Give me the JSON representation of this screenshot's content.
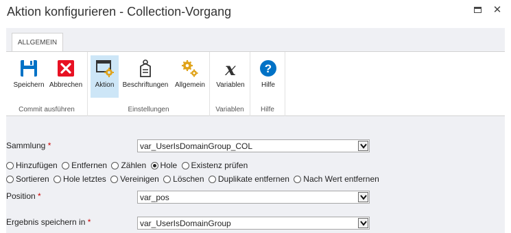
{
  "window": {
    "title": "Aktion konfigurieren - Collection-Vorgang",
    "maximize_icon": "maximize-icon",
    "close_glyph": "✕"
  },
  "tab": {
    "label": "ALLGEMEIN"
  },
  "ribbon": {
    "groups": [
      {
        "label": "Commit ausführen",
        "buttons": [
          {
            "label": "Speichern",
            "icon": "save-icon"
          },
          {
            "label": "Abbrechen",
            "icon": "cancel-icon"
          }
        ]
      },
      {
        "label": "Einstellungen",
        "buttons": [
          {
            "label": "Aktion",
            "icon": "action-settings-icon",
            "active": true
          },
          {
            "label": "Beschriftungen",
            "icon": "tag-icon"
          },
          {
            "label": "Allgemein",
            "icon": "gears-icon"
          }
        ]
      },
      {
        "label": "Variablen",
        "buttons": [
          {
            "label": "Variablen",
            "icon": "variable-x-icon"
          }
        ]
      },
      {
        "label": "Hilfe",
        "buttons": [
          {
            "label": "Hilfe",
            "icon": "help-icon"
          }
        ]
      }
    ]
  },
  "form": {
    "required_marker": "*",
    "collection": {
      "label": "Sammlung",
      "value": "var_UserIsDomainGroup_COL"
    },
    "operations_row1": [
      {
        "label": "Hinzufügen",
        "checked": false
      },
      {
        "label": "Entfernen",
        "checked": false
      },
      {
        "label": "Zählen",
        "checked": false
      },
      {
        "label": "Hole",
        "checked": true
      },
      {
        "label": "Existenz prüfen",
        "checked": false
      }
    ],
    "operations_row2": [
      {
        "label": "Sortieren",
        "checked": false
      },
      {
        "label": "Hole letztes",
        "checked": false
      },
      {
        "label": "Vereinigen",
        "checked": false
      },
      {
        "label": "Löschen",
        "checked": false
      },
      {
        "label": "Duplikate entfernen",
        "checked": false
      },
      {
        "label": "Nach Wert entfernen",
        "checked": false
      }
    ],
    "position": {
      "label": "Position",
      "value": "var_pos"
    },
    "result": {
      "label": "Ergebnis speichern in",
      "value": "var_UserIsDomainGroup"
    }
  },
  "colors": {
    "accent_blue": "#0072c6",
    "cancel_red": "#e81123",
    "gear_gold": "#e0a31a",
    "active_bg": "#cde6f7",
    "panel_bg": "#eff0f4"
  }
}
